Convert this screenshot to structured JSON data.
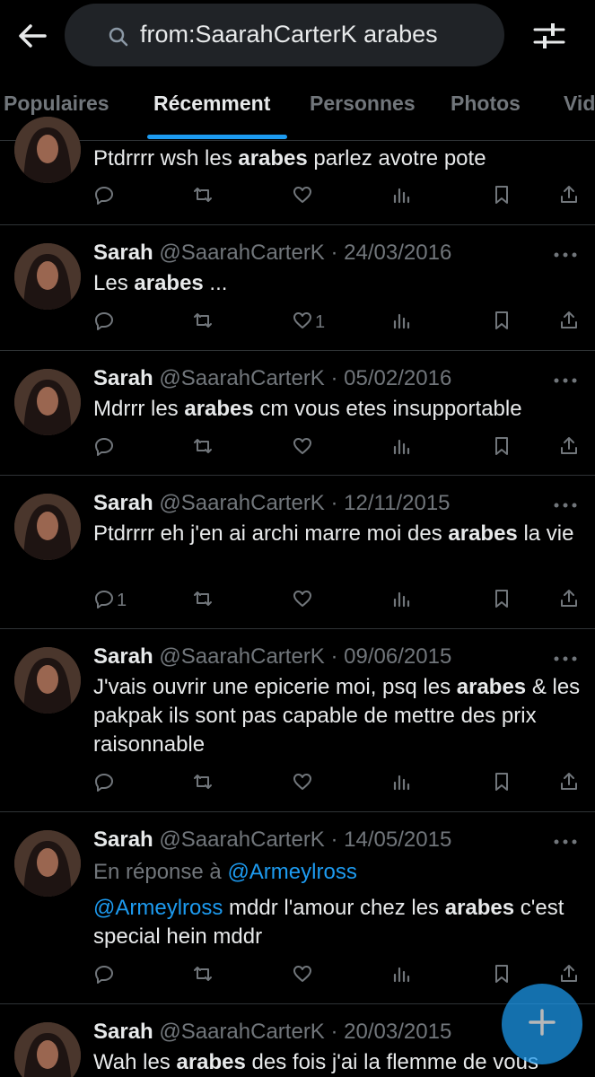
{
  "search": {
    "query": "from:SaarahCarterK arabes"
  },
  "tabs": [
    {
      "label": "Populaires"
    },
    {
      "label": "Récemment"
    },
    {
      "label": "Personnes"
    },
    {
      "label": "Photos"
    },
    {
      "label": "Vid"
    }
  ],
  "tweets": [
    {
      "name": "",
      "handle": "",
      "date": "",
      "text_parts": [
        "Ptdrrrr wsh les ",
        "arabes",
        " parlez avotre pote"
      ],
      "reply_count": "",
      "like_count": ""
    },
    {
      "name": "Sarah",
      "handle": "@SaarahCarterK",
      "date": "24/03/2016",
      "text_parts": [
        "Les ",
        "arabes",
        " ..."
      ],
      "reply_count": "",
      "like_count": "1"
    },
    {
      "name": "Sarah",
      "handle": "@SaarahCarterK",
      "date": "05/02/2016",
      "text_parts": [
        "Mdrrr les ",
        "arabes",
        " cm vous etes insupportable"
      ],
      "reply_count": "",
      "like_count": ""
    },
    {
      "name": "Sarah",
      "handle": "@SaarahCarterK",
      "date": "12/11/2015",
      "text_parts": [
        "Ptdrrrr eh j'en ai archi marre moi des ",
        "arabes",
        " la vie"
      ],
      "reply_count": "1",
      "like_count": ""
    },
    {
      "name": "Sarah",
      "handle": "@SaarahCarterK",
      "date": "09/06/2015",
      "text_parts": [
        "J'vais ouvrir une epicerie moi, psq les ",
        "arabes",
        " & les pakpak ils sont pas capable de mettre des prix raisonnable"
      ],
      "reply_count": "",
      "like_count": ""
    },
    {
      "name": "Sarah",
      "handle": "@SaarahCarterK",
      "date": "14/05/2015",
      "reply_prefix": "En réponse à ",
      "reply_mention": "@Armeylross",
      "mention": "@Armeylross",
      "text_parts": [
        " mddr l'amour chez les ",
        "arabes",
        " c'est special hein mddr"
      ],
      "reply_count": "",
      "like_count": ""
    },
    {
      "name": "Sarah",
      "handle": "@SaarahCarterK",
      "date": "20/03/2015",
      "text_parts": [
        "Wah les ",
        "arabes",
        " des fois j'ai la flemme de vous"
      ],
      "reply_count": "",
      "like_count": ""
    }
  ],
  "separator": "·",
  "icons": {
    "back": "arrow-left-icon",
    "search": "search-icon",
    "filter": "sliders-icon",
    "reply": "reply-icon",
    "retweet": "retweet-icon",
    "like": "heart-icon",
    "views": "views-icon",
    "bookmark": "bookmark-icon",
    "share": "share-icon",
    "more": "more-icon",
    "compose": "plus-icon"
  },
  "colors": {
    "accent": "#1d9bf0",
    "background": "#000000",
    "muted": "#71767b",
    "text": "#e7e9ea"
  }
}
